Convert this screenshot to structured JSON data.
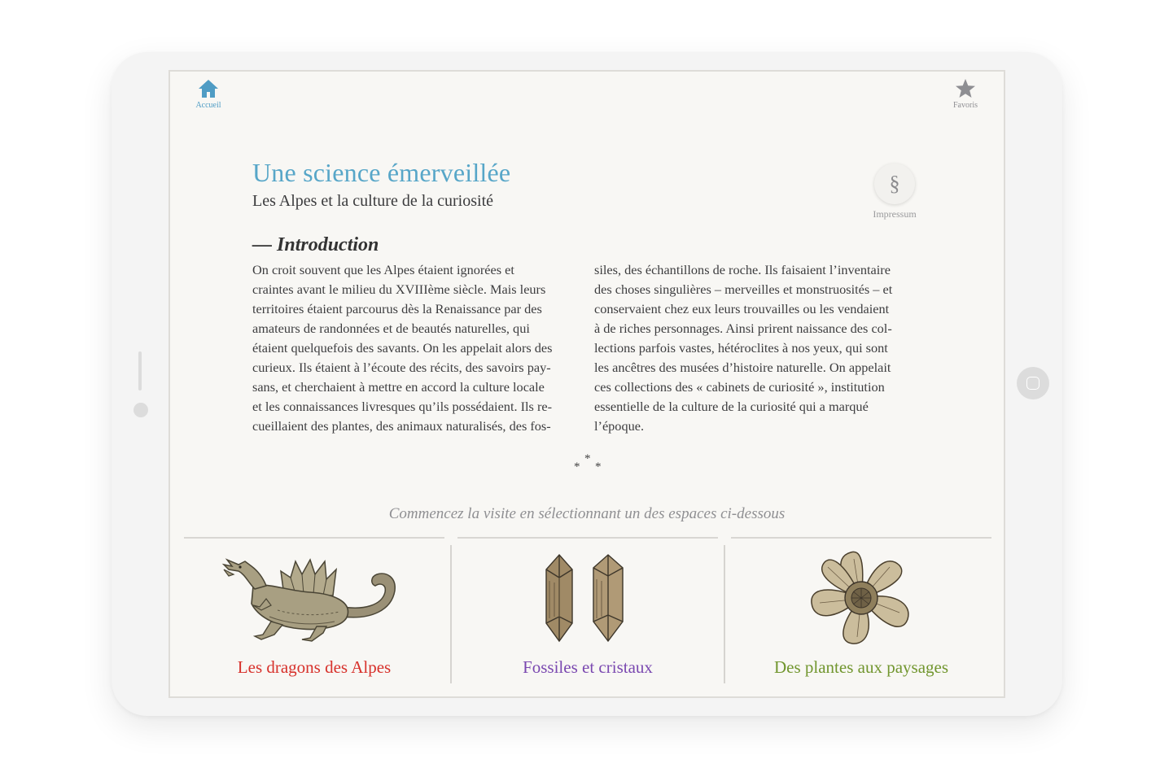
{
  "nav": {
    "home_label": "Accueil",
    "favorites_label": "Favoris"
  },
  "header": {
    "title": "Une science émerveillée",
    "subtitle": "Les Alpes et la culture de la curiosité"
  },
  "impressum": {
    "symbol": "§",
    "label": "Impressum"
  },
  "intro": {
    "heading": "— Introduction",
    "left_lines": [
      "On croit souvent que les Alpes étaient ignorées et",
      "craintes avant le milieu du XVIIIème siècle. Mais leurs",
      "territoires étaient parcourus dès la Renaissance par des",
      "amateurs de randonnées et de beautés naturelles, qui",
      "étaient quelquefois des savants. On les appelait alors des",
      "curieux. Ils étaient à l’écoute des récits, des savoirs pay-",
      "sans, et cherchaient à mettre en accord la culture locale",
      "et les connaissances livresques qu’ils possédaient. Ils re-",
      "cueillaient des plantes, des animaux naturalisés, des fos-"
    ],
    "right_lines": [
      "siles, des échantillons de roche. Ils faisaient l’inventaire",
      "des choses singulières – merveilles et monstruosités – et",
      "conservaient chez eux leurs trouvailles ou les vendaient",
      "à de riches personnages. Ainsi prirent naissance des col-",
      "lections parfois vastes, hétéroclites à nos yeux, qui sont",
      "les ancêtres des musées d’histoire naturelle. On appelait",
      "ces collections des « cabinets de curiosité », institution",
      "essentielle de la culture de la curiosité qui a marqué",
      "l’époque."
    ]
  },
  "cta": "Commencez la visite en sélectionnant un des espaces ci-dessous",
  "spaces": [
    {
      "label": "Les dragons des Alpes",
      "color": "#d7312b",
      "icon": "dragon-illustration"
    },
    {
      "label": "Fossiles et cristaux",
      "color": "#7a48b0",
      "icon": "crystal-illustration"
    },
    {
      "label": "Des plantes aux paysages",
      "color": "#71962e",
      "icon": "flower-illustration"
    }
  ],
  "colors": {
    "accent": "#57a6c8",
    "nav_active": "#4f9cc4",
    "nav_inactive": "#8e8e92"
  }
}
